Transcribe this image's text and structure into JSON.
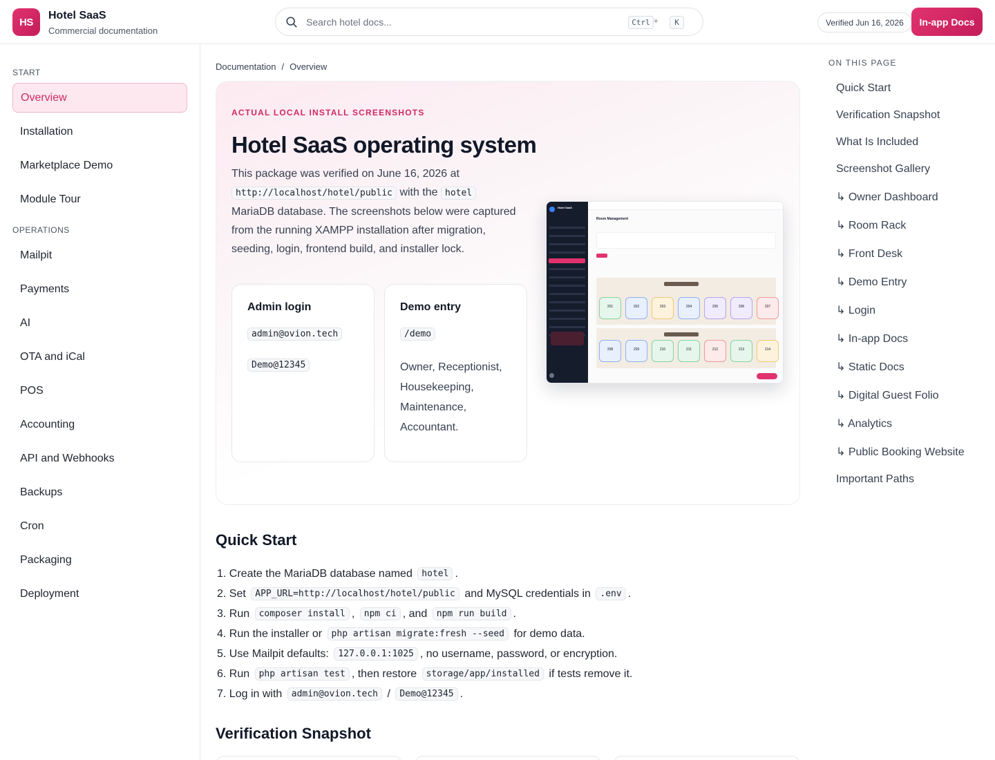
{
  "header": {
    "logo_text": "HS",
    "brand_name": "Hotel SaaS",
    "brand_sub": "Commercial documentation",
    "search_placeholder": "Search hotel docs...",
    "shortcut_ctrl": "Ctrl",
    "shortcut_plus": "+",
    "shortcut_key": "K",
    "verified": "Verified Jun 16, 2026",
    "inapp_docs": "In-app Docs"
  },
  "sidebar": {
    "section_start": "START",
    "start_items": [
      "Overview",
      "Installation",
      "Marketplace Demo",
      "Module Tour"
    ],
    "section_operations": "OPERATIONS",
    "operations_items": [
      "Mailpit",
      "Payments",
      "AI",
      "OTA and iCal",
      "POS",
      "Accounting",
      "API and Webhooks",
      "Backups",
      "Cron",
      "Packaging",
      "Deployment"
    ]
  },
  "breadcrumb": [
    "Documentation",
    "/",
    "Overview"
  ],
  "hero": {
    "eyebrow": "ACTUAL LOCAL INSTALL SCREENSHOTS",
    "title": "Hotel SaaS operating system",
    "text_1": "This package was verified on June 16, 2026 at",
    "code_url": "http://localhost/hotel/public",
    "text_2": "with the",
    "code_db": "hotel",
    "text_3": "MariaDB database. The screenshots below were captured from the running XAMPP installation after migration, seeding, login, frontend build, and installer lock."
  },
  "cards": {
    "admin": {
      "title": "Admin login",
      "email": "admin@ovion.tech",
      "password": "Demo@12345"
    },
    "demo": {
      "title": "Demo entry",
      "path": "/demo",
      "roles": "Owner, Receptionist, Housekeeping, Maintenance, Accountant."
    }
  },
  "quick_start": {
    "title": "Quick Start",
    "steps": [
      {
        "n": "1.",
        "a": "Create the MariaDB database named",
        "c1": "hotel",
        "b": "."
      },
      {
        "n": "2.",
        "a": "Set",
        "c1": "APP_URL=http://localhost/hotel/public",
        "b": "and MySQL credentials in",
        "c2": ".env",
        "c": "."
      },
      {
        "n": "3.",
        "a": "Run",
        "c1": "composer install",
        "b": ",",
        "c2": "npm ci",
        "c": ", and",
        "c3": "npm run build",
        "d": "."
      },
      {
        "n": "4.",
        "a": "Run the installer or",
        "c1": "php artisan migrate:fresh --seed",
        "b": "for demo data."
      },
      {
        "n": "5.",
        "a": "Use Mailpit defaults:",
        "c1": "127.0.0.1:1025",
        "b": ", no username, password, or encryption."
      },
      {
        "n": "6.",
        "a": "Run",
        "c1": "php artisan test",
        "b": ", then restore",
        "c2": "storage/app/installed",
        "c": "if tests remove it."
      },
      {
        "n": "7.",
        "a": "Log in with",
        "c1": "admin@ovion.tech",
        "b": "/",
        "c2": "Demo@12345",
        "c": "."
      }
    ]
  },
  "verification": {
    "title": "Verification Snapshot"
  },
  "toc": {
    "head": "ON THIS PAGE",
    "items": [
      "Quick Start",
      "Verification Snapshot",
      "What Is Included",
      "Screenshot Gallery",
      "↳ Owner Dashboard",
      "↳ Room Rack",
      "↳ Front Desk",
      "↳ Demo Entry",
      "↳ Login",
      "↳ In-app Docs",
      "↳ Static Docs",
      "↳ Digital Guest Folio",
      "↳ Analytics",
      "↳ Public Booking Website",
      "Important Paths"
    ]
  },
  "screenshot": {
    "app_name": "Hotel SaaS",
    "page_title": "Room Management",
    "rooms_row1": [
      "201",
      "202",
      "203",
      "204",
      "205",
      "206",
      "207"
    ],
    "rooms_row2": [
      "208",
      "209",
      "210",
      "211",
      "212",
      "213",
      "214"
    ]
  },
  "colors": {
    "accent": "#d12a63",
    "accent_light": "#fde8ef",
    "sidebar_dark": "#151c2c"
  }
}
